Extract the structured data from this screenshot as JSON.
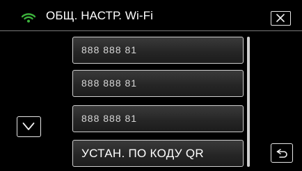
{
  "header": {
    "title": "ОБЩ. НАСТР. Wi-Fi",
    "wifi_icon": "wifi-icon",
    "close_icon": "close-icon",
    "accent_color": "#3cb23c"
  },
  "list": {
    "items": [
      {
        "label": "888 888 81"
      },
      {
        "label": "888 888 81"
      },
      {
        "label": "888 888 81"
      },
      {
        "label": "УСТАН. ПО КОДУ QR"
      }
    ]
  },
  "controls": {
    "down_icon": "chevron-down-icon",
    "back_icon": "back-arrow-icon"
  }
}
